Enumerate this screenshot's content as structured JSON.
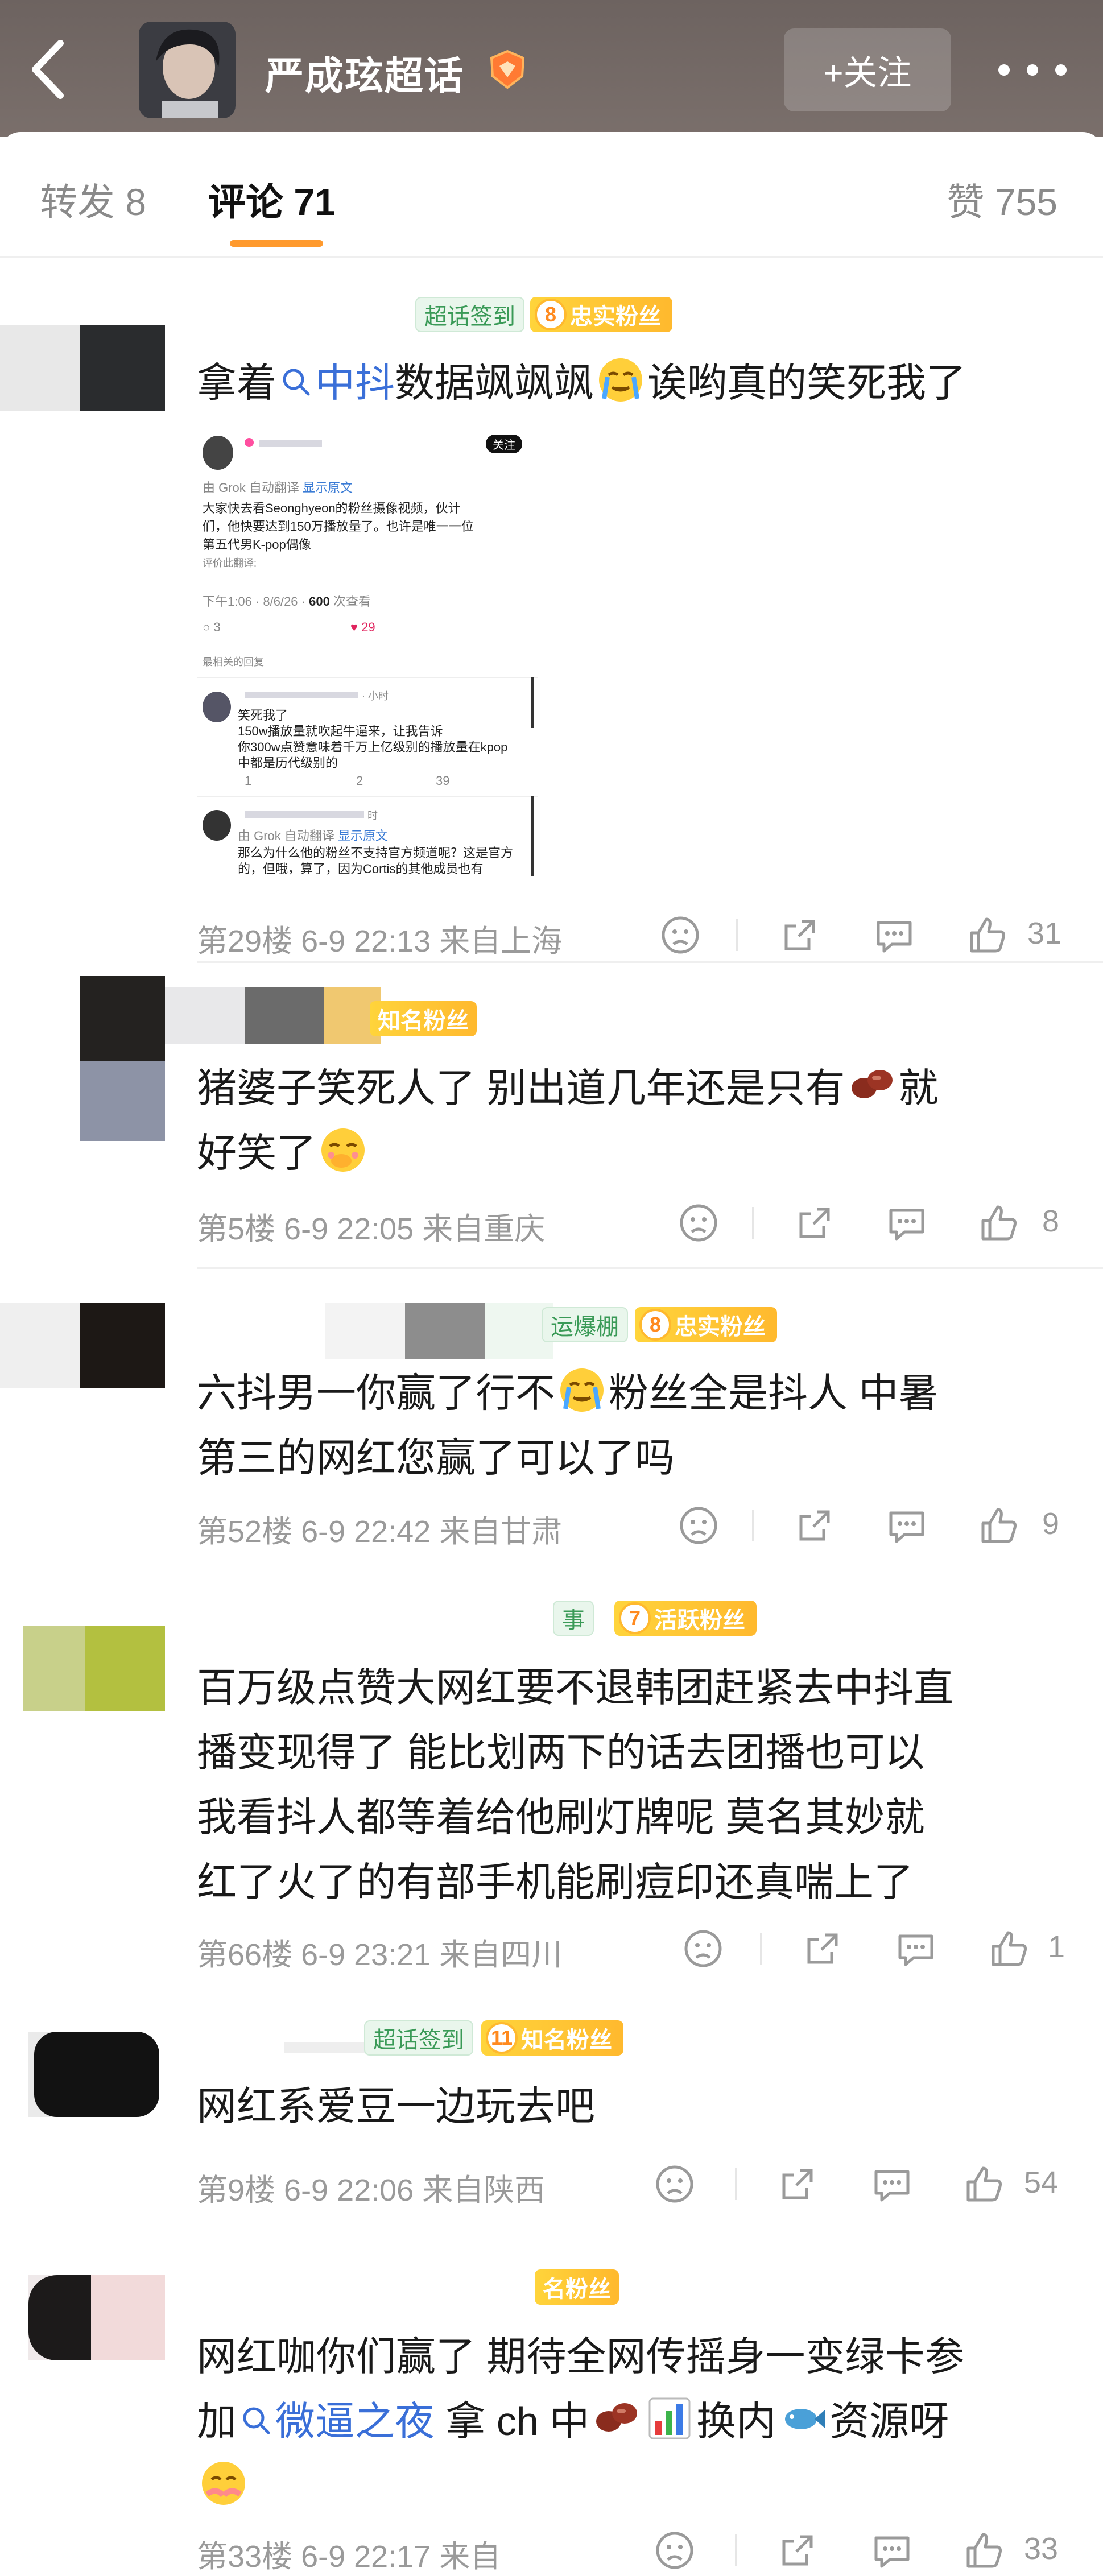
{
  "header": {
    "title": "严成玹超话",
    "follow_label": "+关注"
  },
  "tabs": {
    "repost": "转发 8",
    "comment": "评论 71",
    "like": "赞 755"
  },
  "comments": [
    {
      "badge_checkin": "超话签到",
      "badge_fan_level": "8",
      "badge_fan": "忠实粉丝",
      "text_before": "拿着",
      "link": "中抖",
      "text_after": "数据飒飒飒",
      "text_tail": "诶哟真的笑死我了",
      "floor": "第29楼  6-9 22:13  来自上海",
      "likes": "31"
    },
    {
      "badge_fan_partial": "知名粉丝",
      "text": "猪婆子笑死人了 别出道几年还是只有",
      "text_tail": "就",
      "text_line2": "好笑了",
      "floor": "第5楼  6-9 22:05  来自重庆",
      "likes": "8"
    },
    {
      "badge_topic_partial": "运爆棚",
      "badge_fan_level": "8",
      "badge_fan": "忠实粉丝",
      "text": "六抖男一你赢了行不",
      "text_tail": "粉丝全是抖人 中暑",
      "text_line2": "第三的网红您赢了可以了吗",
      "floor": "第52楼  6-9 22:42  来自甘肃",
      "likes": "9"
    },
    {
      "badge_topic_partial": "事",
      "badge_fan_level": "7",
      "badge_fan": "活跃粉丝",
      "lines": [
        "百万级点赞大网红要不退韩团赶紧去中抖直",
        "播变现得了 能比划两下的话去团播也可以",
        "我看抖人都等着给他刷灯牌呢 莫名其妙就",
        "红了火了的有部手机能刷痘印还真喘上了"
      ],
      "floor": "第66楼  6-9 23:21  来自四川",
      "likes": "1"
    },
    {
      "badge_checkin": "超话签到",
      "badge_fan_level": "11",
      "badge_fan": "知名粉丝",
      "text": "网红系爱豆一边玩去吧",
      "floor": "第9楼  6-9 22:06  来自陕西",
      "likes": "54"
    },
    {
      "badge_fan_partial": "名粉丝",
      "line1": "网红咖你们赢了 期待全网传摇身一变绿卡参",
      "line2_before": "加",
      "link": "微逼之夜",
      "line2_mid": "拿 ch 中",
      "line2_after": "换内",
      "line2_end": "资源呀",
      "floor": "第33楼  6-9 22:17  来自",
      "likes": "33"
    }
  ],
  "embed": {
    "follow": "关注",
    "translate": "由 Grok 自动翻译",
    "show_original": "显示原文",
    "body": [
      "大家快去看Seonghyeon的粉丝摄像视频，伙计",
      "们，他快要达到150万播放量了。也许是唯一一位",
      "第五代男K-pop偶像"
    ],
    "rate": "评价此翻译:",
    "time_prefix": "下午1:06 · 8/6/26 · ",
    "views": "600",
    "views_suffix": " 次查看",
    "reply_count": "3",
    "like_count": "29",
    "best_replies": "最相关的回复",
    "reply1_time": "· 小时",
    "reply1": [
      "笑死我了",
      "150w播放量就吹起牛逼来，让我告诉",
      "你300w点赞意味着千万上亿级别的播放量在kpop",
      "中都是历代级别的"
    ],
    "reply1_counts": [
      "1",
      "2",
      "39"
    ],
    "reply2_time": "时",
    "reply2": [
      "那么为什么他的粉丝不支持官方频道呢？这是官方",
      "的，但哦，算了，因为Cortis的其他成员也有"
    ]
  },
  "colors": {
    "accent": "#ff9a2e",
    "link": "#3a6fd8",
    "badge_green": "#3a9a57",
    "fan_badge": "#ffc233"
  }
}
